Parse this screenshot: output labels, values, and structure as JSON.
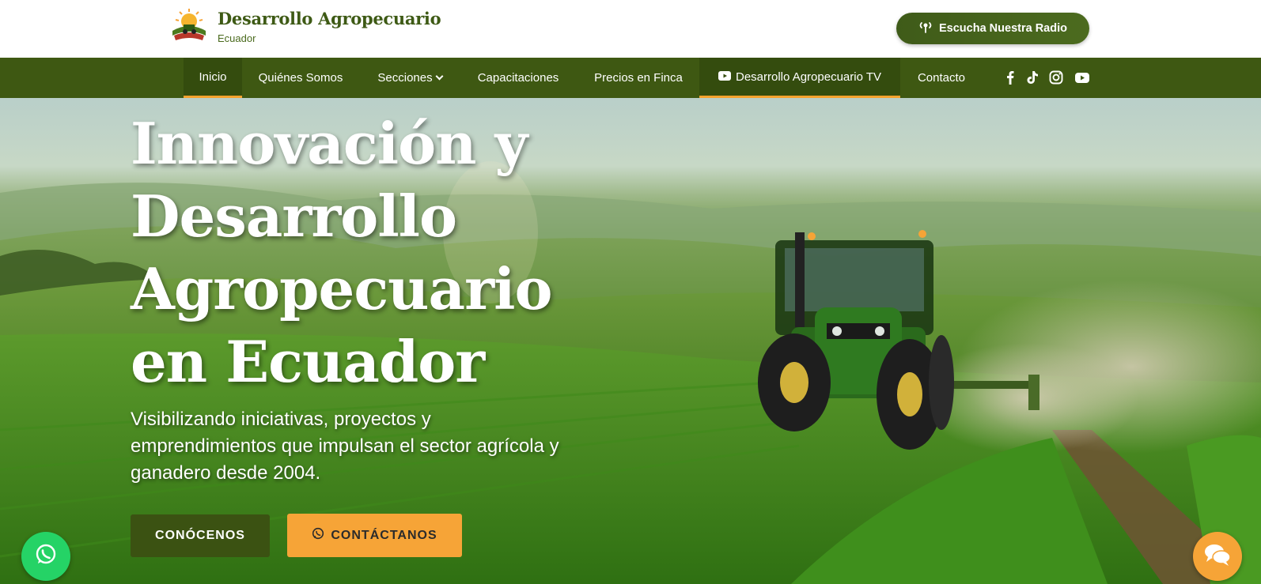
{
  "header": {
    "brand_title": "Desarrollo Agropecuario",
    "brand_subtitle": "Ecuador",
    "radio_button_label": "Escucha Nuestra Radio"
  },
  "nav": {
    "items": [
      {
        "label": "Inicio",
        "active": true
      },
      {
        "label": "Quiénes Somos"
      },
      {
        "label": "Secciones",
        "has_dropdown": true
      },
      {
        "label": "Capacitaciones"
      },
      {
        "label": "Precios en Finca"
      },
      {
        "label": "Desarrollo Agropecuario TV",
        "icon": "youtube-icon"
      },
      {
        "label": "Contacto"
      }
    ],
    "social_icons": [
      "facebook-icon",
      "tiktok-icon",
      "instagram-icon",
      "youtube-icon"
    ]
  },
  "hero": {
    "title": "Innovación y Desarrollo Agropecuario en Ecuador",
    "subtitle": "Visibilizando iniciativas, proyectos y emprendimientos que impulsan el sector agrícola y ganadero desde 2004.",
    "primary_button": "CONÓCENOS",
    "secondary_button": "CONTÁCTANOS"
  },
  "floating": {
    "left_icon": "whatsapp-icon",
    "right_icon": "chat-icon"
  },
  "colors": {
    "brand_green": "#3e5812",
    "accent_orange": "#f6a437",
    "whatsapp_green": "#25d366"
  }
}
